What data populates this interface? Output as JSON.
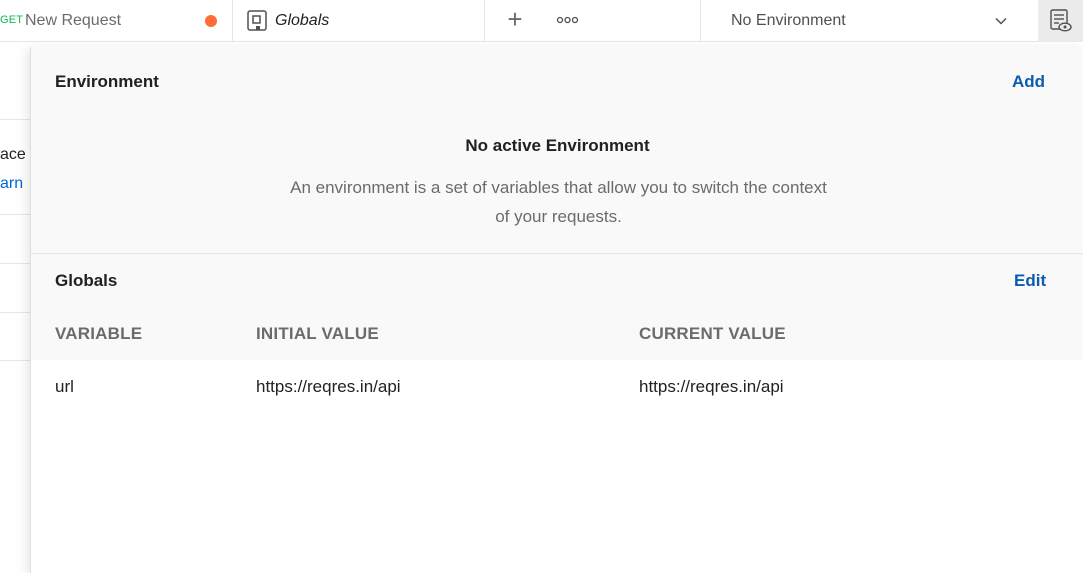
{
  "tabs": {
    "request": {
      "method": "GET",
      "title": "New Request"
    },
    "globals": {
      "title": "Globals"
    }
  },
  "environment_selector": {
    "value": "No Environment"
  },
  "background": {
    "text_a": "ace",
    "text_b": "arn"
  },
  "popover": {
    "environment": {
      "title": "Environment",
      "add_label": "Add",
      "empty_title": "No active Environment",
      "empty_description": "An environment is a set of variables that allow you to switch the context of your requests."
    },
    "globals": {
      "title": "Globals",
      "edit_label": "Edit",
      "columns": [
        "VARIABLE",
        "INITIAL VALUE",
        "CURRENT VALUE"
      ],
      "rows": [
        {
          "variable": "url",
          "initial": "https://reqres.in/api",
          "current": "https://reqres.in/api"
        }
      ]
    }
  },
  "colors": {
    "accent_link": "#0b5cad",
    "unsaved_dot": "#ff6c37",
    "method_get": "#0cbb52"
  },
  "icons": [
    "globals-tab-icon",
    "plus-icon",
    "more-icon",
    "chevron-down-icon",
    "environment-quick-look-icon"
  ]
}
